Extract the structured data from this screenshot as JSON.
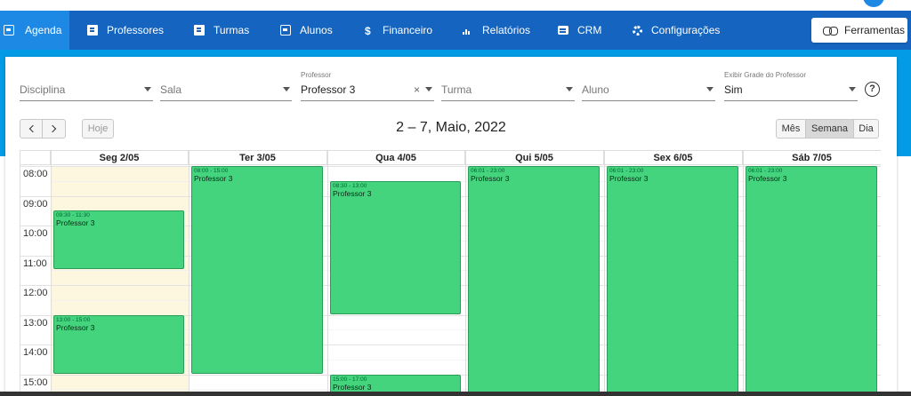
{
  "nav": {
    "items": [
      {
        "label": "Agenda",
        "icon": "calendar-icon",
        "active": true
      },
      {
        "label": "Professores",
        "icon": "badge-icon"
      },
      {
        "label": "Turmas",
        "icon": "book-icon"
      },
      {
        "label": "Alunos",
        "icon": "id-card-icon"
      },
      {
        "label": "Financeiro",
        "icon": "dollar-icon"
      },
      {
        "label": "Relatórios",
        "icon": "bar-chart-icon"
      },
      {
        "label": "CRM",
        "icon": "chat-icon"
      },
      {
        "label": "Configurações",
        "icon": "gear-icon"
      }
    ],
    "tools_label": "Ferramentas",
    "colors": {
      "navbar": "#1565c0",
      "active": "#1e88e5",
      "band": "#039be5"
    }
  },
  "filters": {
    "disciplina": {
      "placeholder": "Disciplina"
    },
    "sala": {
      "placeholder": "Sala"
    },
    "professor": {
      "label": "Professor",
      "value": "Professor 3",
      "clear": "×"
    },
    "turma": {
      "placeholder": "Turma"
    },
    "aluno": {
      "placeholder": "Aluno"
    },
    "grade": {
      "label": "Exibir Grade do Professor",
      "value": "Sim"
    },
    "help": "?"
  },
  "toolbar": {
    "today": "Hoje",
    "title": "2 – 7, Maio, 2022",
    "views": {
      "month": "Mês",
      "week": "Semana",
      "day": "Dia",
      "selected": "week"
    }
  },
  "calendar": {
    "days": [
      "Seg 2/05",
      "Ter 3/05",
      "Qua 4/05",
      "Qui 5/05",
      "Sex 6/05",
      "Sáb 7/05"
    ],
    "today_index": 0,
    "hours": [
      "08:00",
      "09:00",
      "10:00",
      "11:00",
      "12:00",
      "13:00",
      "14:00",
      "15:00"
    ],
    "event_color": "#44d47e",
    "events": [
      {
        "day": 0,
        "time": "09:30 - 11:30",
        "title": "Professor 3"
      },
      {
        "day": 0,
        "time": "13:00 - 15:00",
        "title": "Professor 3"
      },
      {
        "day": 1,
        "time": "08:00 - 15:00",
        "title": "Professor 3"
      },
      {
        "day": 2,
        "time": "08:30 - 13:00",
        "title": "Professor 3"
      },
      {
        "day": 2,
        "time": "15:00 - 17:00",
        "title": "Professor 3"
      },
      {
        "day": 3,
        "time": "06:01 - 23:00",
        "title": "Professor 3"
      },
      {
        "day": 4,
        "time": "06:01 - 23:00",
        "title": "Professor 3"
      },
      {
        "day": 5,
        "time": "06:01 - 23:00",
        "title": "Professor 3"
      }
    ]
  }
}
